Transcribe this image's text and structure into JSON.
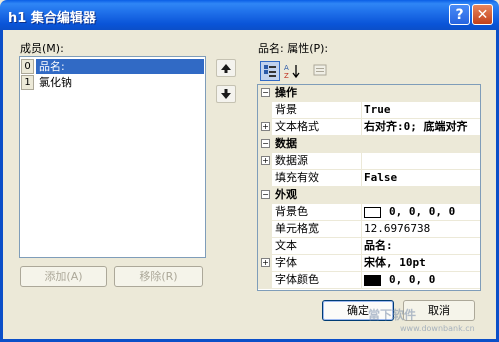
{
  "window": {
    "title": "h1 集合编辑器",
    "help_glyph": "?",
    "close_glyph": "✕"
  },
  "members": {
    "label": "成员(M):",
    "items": [
      {
        "index": "0",
        "name": "品名:"
      },
      {
        "index": "1",
        "name": "氯化钠"
      }
    ],
    "add_label": "添加(A)",
    "remove_label": "移除(R)"
  },
  "properties": {
    "label": "品名: 属性(P):",
    "categories": [
      {
        "name": "操作",
        "rows": [
          {
            "name": "背景",
            "value": "True",
            "expandable": false
          },
          {
            "name": "文本格式",
            "value": "右对齐:0; 底端对齐",
            "expandable": true
          }
        ]
      },
      {
        "name": "数据",
        "rows": [
          {
            "name": "数据源",
            "value": "",
            "expandable": true
          },
          {
            "name": "填充有效",
            "value": "False",
            "expandable": false
          }
        ]
      },
      {
        "name": "外观",
        "rows": [
          {
            "name": "背景色",
            "value": "0, 0, 0, 0",
            "expandable": false,
            "swatch": "#ffffff"
          },
          {
            "name": "单元格宽",
            "value": "12.6976738",
            "expandable": false
          },
          {
            "name": "文本",
            "value": "品名:",
            "expandable": false
          },
          {
            "name": "字体",
            "value": "宋体, 10pt",
            "expandable": true
          },
          {
            "name": "字体颜色",
            "value": "0, 0, 0",
            "expandable": false,
            "swatch": "#000000"
          }
        ]
      }
    ]
  },
  "footer": {
    "ok_label": "确定",
    "cancel_label": "取消"
  },
  "watermark": {
    "text": "當下软件",
    "url": "www.downbank.cn"
  },
  "colors": {
    "titlebar": "#0a54d8",
    "dialog": "#ece9d8",
    "selection": "#316ac5"
  }
}
